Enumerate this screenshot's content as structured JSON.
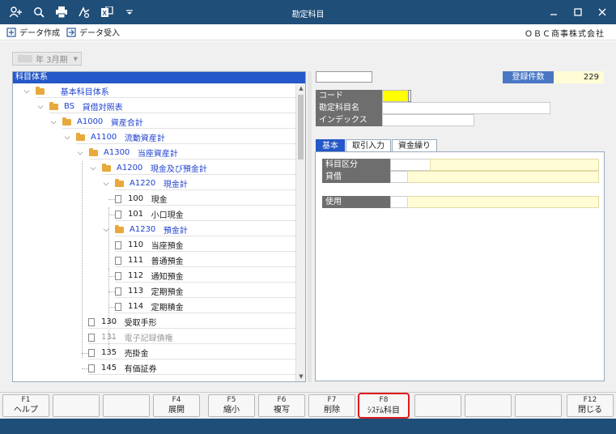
{
  "window": {
    "title": "勘定科目",
    "toolbar_icons": [
      "user-add-icon",
      "search-icon",
      "print-icon",
      "fax-icon",
      "export-icon",
      "dropdown-icon"
    ],
    "controls": [
      "minimize-icon",
      "maximize-icon",
      "close-icon"
    ]
  },
  "menubar": {
    "items": [
      {
        "label": "データ作成",
        "icon": "data-create-icon"
      },
      {
        "label": "データ受入",
        "icon": "data-import-icon"
      }
    ],
    "company": "ＯＢＣ商事株式会社"
  },
  "period": {
    "value": "年 3月期"
  },
  "tree": {
    "header": "科目体系",
    "nodes": [
      {
        "code": "",
        "name": "基本科目体系",
        "type": "folder",
        "expanded": true,
        "color": "blue"
      },
      {
        "code": "BS",
        "name": "貸借対照表",
        "type": "folder",
        "expanded": true,
        "color": "blue"
      },
      {
        "code": "A1000",
        "name": "資産合計",
        "type": "folder",
        "expanded": true,
        "color": "blue"
      },
      {
        "code": "A1100",
        "name": "流動資産計",
        "type": "folder",
        "expanded": true,
        "color": "blue"
      },
      {
        "code": "A1300",
        "name": "当座資産計",
        "type": "folder",
        "expanded": true,
        "color": "blue"
      },
      {
        "code": "A1200",
        "name": "現金及び預金計",
        "type": "folder",
        "expanded": true,
        "color": "blue"
      },
      {
        "code": "A1220",
        "name": "現金計",
        "type": "folder",
        "expanded": true,
        "color": "blue"
      },
      {
        "code": "100",
        "name": "現金",
        "type": "doc",
        "color": "black"
      },
      {
        "code": "101",
        "name": "小口現金",
        "type": "doc",
        "color": "black"
      },
      {
        "code": "A1230",
        "name": "預金計",
        "type": "folder",
        "expanded": true,
        "color": "blue"
      },
      {
        "code": "110",
        "name": "当座預金",
        "type": "doc",
        "color": "black"
      },
      {
        "code": "111",
        "name": "普通預金",
        "type": "doc",
        "color": "black"
      },
      {
        "code": "112",
        "name": "通知預金",
        "type": "doc",
        "color": "black"
      },
      {
        "code": "113",
        "name": "定期預金",
        "type": "doc",
        "color": "black"
      },
      {
        "code": "114",
        "name": "定期積金",
        "type": "doc",
        "color": "black"
      },
      {
        "code": "130",
        "name": "受取手形",
        "type": "doc",
        "color": "black"
      },
      {
        "code": "131",
        "name": "電子記録債権",
        "type": "doc",
        "color": "gray"
      },
      {
        "code": "135",
        "name": "売掛金",
        "type": "doc",
        "color": "black"
      },
      {
        "code": "145",
        "name": "有価証券",
        "type": "doc",
        "color": "black"
      }
    ]
  },
  "detail": {
    "registered_label": "登録件数",
    "registered_count": "229",
    "fields": [
      {
        "label": "コード",
        "value": ""
      },
      {
        "label": "勘定科目名",
        "value": ""
      },
      {
        "label": "インデックス",
        "value": ""
      }
    ],
    "tabs": [
      "基本",
      "取引入力",
      "資金繰り"
    ],
    "active_tab": "基本",
    "basic_fields": [
      {
        "label": "科目区分",
        "value": ""
      },
      {
        "label": "貸借",
        "value": ""
      },
      {
        "label": "使用",
        "value": ""
      }
    ]
  },
  "fkeys": [
    {
      "key": "F1",
      "label": "ヘルプ",
      "enabled": true
    },
    {
      "key": "",
      "label": "",
      "enabled": false
    },
    {
      "key": "",
      "label": "",
      "enabled": false
    },
    {
      "key": "F4",
      "label": "展開",
      "enabled": true
    },
    {
      "key": "F5",
      "label": "縮小",
      "enabled": true
    },
    {
      "key": "F6",
      "label": "複写",
      "enabled": true
    },
    {
      "key": "F7",
      "label": "削除",
      "enabled": true
    },
    {
      "key": "F8",
      "label": "ｼｽﾃﾑ科目",
      "enabled": true,
      "highlighted": true
    },
    {
      "key": "",
      "label": "",
      "enabled": false
    },
    {
      "key": "",
      "label": "",
      "enabled": false
    },
    {
      "key": "",
      "label": "",
      "enabled": false
    },
    {
      "key": "F12",
      "label": "閉じる",
      "enabled": true
    }
  ],
  "colors": {
    "titlebar": "#1f4e79",
    "tree_header": "#2457c7",
    "folder": "#e8a93c",
    "blue_text": "#1e3fcf",
    "field_label": "#6e6e6e",
    "code_highlight": "#ffff00",
    "highlight_border": "#e01b1b"
  }
}
